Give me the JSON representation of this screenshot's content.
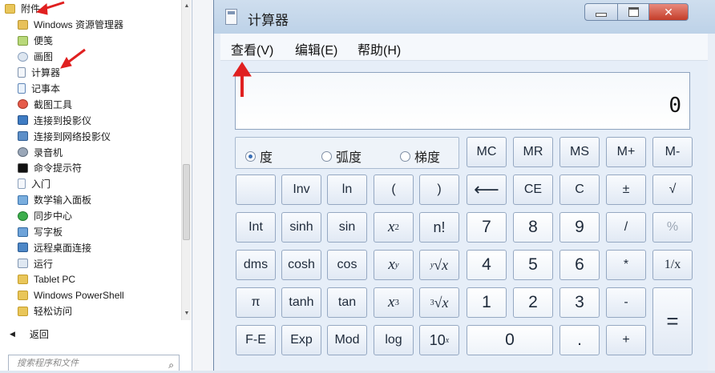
{
  "start_menu": {
    "folder_label": "附件",
    "items": [
      {
        "label": "Windows 资源管理器",
        "icon": "explorer-icon"
      },
      {
        "label": "便笺",
        "icon": "sticky-notes-icon"
      },
      {
        "label": "画图",
        "icon": "paint-icon"
      },
      {
        "label": "计算器",
        "icon": "calculator-icon"
      },
      {
        "label": "记事本",
        "icon": "notepad-icon"
      },
      {
        "label": "截图工具",
        "icon": "snipping-tool-icon"
      },
      {
        "label": "连接到投影仪",
        "icon": "projector-icon"
      },
      {
        "label": "连接到网络投影仪",
        "icon": "network-projector-icon"
      },
      {
        "label": "录音机",
        "icon": "sound-recorder-icon"
      },
      {
        "label": "命令提示符",
        "icon": "command-prompt-icon"
      },
      {
        "label": "入门",
        "icon": "getting-started-icon"
      },
      {
        "label": "数学输入面板",
        "icon": "math-input-icon"
      },
      {
        "label": "同步中心",
        "icon": "sync-center-icon"
      },
      {
        "label": "写字板",
        "icon": "wordpad-icon"
      },
      {
        "label": "远程桌面连接",
        "icon": "remote-desktop-icon"
      },
      {
        "label": "运行",
        "icon": "run-icon"
      },
      {
        "label": "Tablet PC",
        "icon": "folder-icon"
      },
      {
        "label": "Windows PowerShell",
        "icon": "folder-icon"
      },
      {
        "label": "轻松访问",
        "icon": "folder-icon"
      }
    ],
    "back_label": "返回",
    "search_placeholder": "搜索程序和文件"
  },
  "calculator": {
    "title": "计算器",
    "menu": [
      "查看(V)",
      "编辑(E)",
      "帮助(H)"
    ],
    "display_value": "0",
    "modes": [
      {
        "label": "度",
        "selected": true
      },
      {
        "label": "弧度",
        "selected": false
      },
      {
        "label": "梯度",
        "selected": false
      }
    ],
    "buttons": {
      "mc": "MC",
      "mr": "MR",
      "ms": "MS",
      "mplus": "M+",
      "mminus": "M-",
      "inv": "Inv",
      "ln": "ln",
      "lparen": "(",
      "rparen": ")",
      "backspace": "⟵",
      "ce": "CE",
      "c": "C",
      "plusminus": "±",
      "sqrt": "√",
      "int": "Int",
      "sinh": "sinh",
      "sin": "sin",
      "x2_base": "x",
      "x2_exp": "2",
      "fact": "n!",
      "d7": "7",
      "d8": "8",
      "d9": "9",
      "div": "/",
      "pct": "%",
      "dms": "dms",
      "cosh": "cosh",
      "cos": "cos",
      "xy_base": "x",
      "xy_exp": "y",
      "yroot_index": "y",
      "yroot_rad": "√x",
      "d4": "4",
      "d5": "5",
      "d6": "6",
      "mul": "*",
      "recip": "1/x",
      "pi": "π",
      "tanh": "tanh",
      "tan": "tan",
      "x3_base": "x",
      "x3_exp": "3",
      "cbrt_index": "3",
      "cbrt_rad": "√x",
      "d1": "1",
      "d2": "2",
      "d3": "3",
      "sub": "-",
      "eq": "=",
      "fe": "F-E",
      "exp": "Exp",
      "mod": "Mod",
      "log": "log",
      "tenx_base": "10",
      "tenx_exp": "x",
      "d0": "0",
      "dot": ".",
      "add": "+"
    },
    "annotation_color": "#e02020"
  }
}
